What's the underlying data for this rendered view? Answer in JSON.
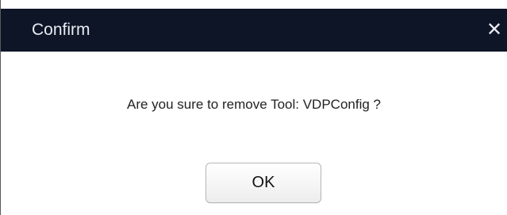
{
  "dialog": {
    "title": "Confirm",
    "close_glyph": "✕",
    "close_icon": "close-icon",
    "message": "Are you sure to remove Tool: VDPConfig ?",
    "ok_label": "OK"
  },
  "colors": {
    "titlebar_bg": "#0d1526",
    "title_text": "#e8ecf2",
    "body_bg": "#ffffff"
  }
}
